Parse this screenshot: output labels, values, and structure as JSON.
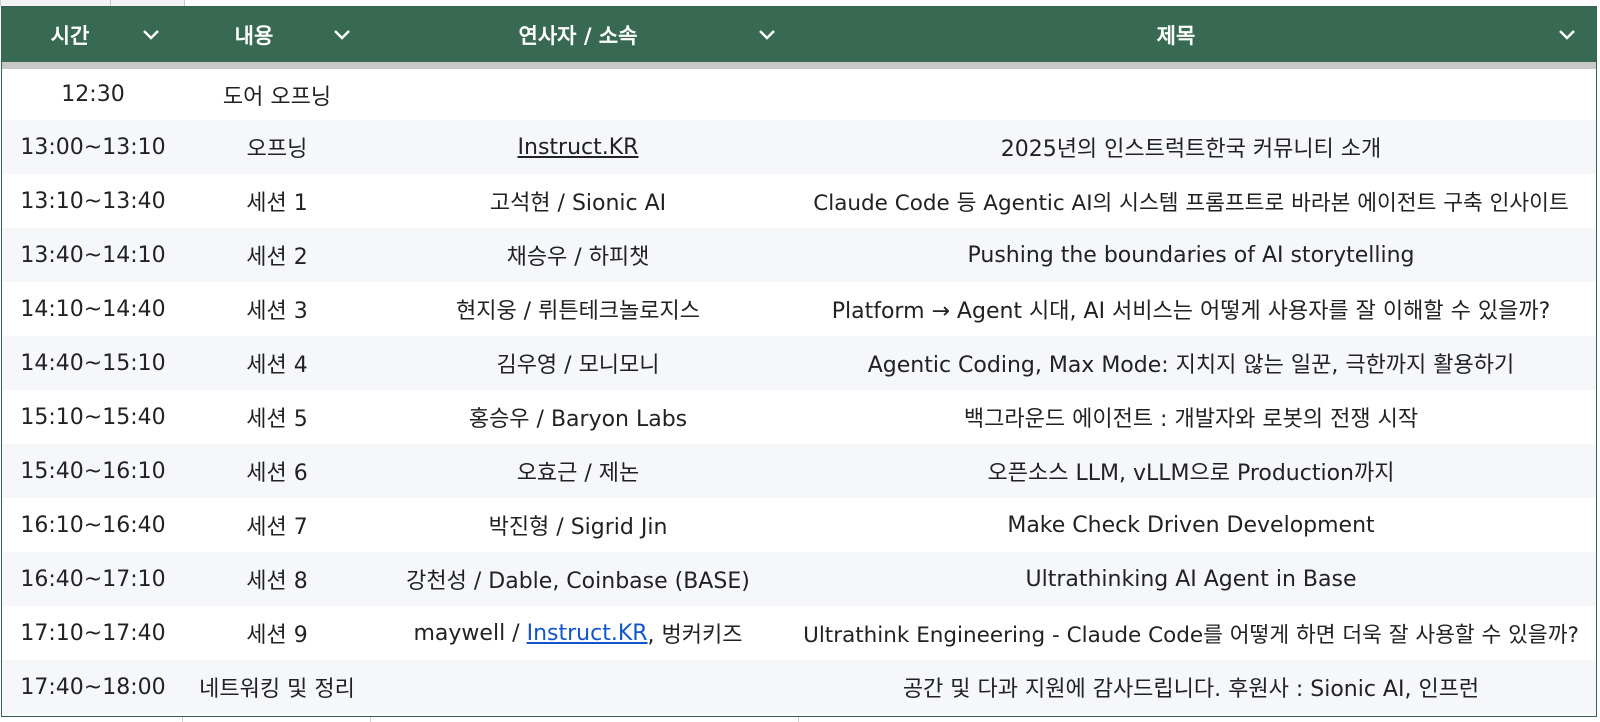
{
  "header": {
    "columns": [
      {
        "label": "시간"
      },
      {
        "label": "내용"
      },
      {
        "label": "연사자 / 소속"
      },
      {
        "label": "제목"
      }
    ]
  },
  "rows": [
    {
      "time": "12:30",
      "content": "도어 오프닝",
      "speaker": "",
      "title": ""
    },
    {
      "time": "13:00~13:10",
      "content": "오프닝",
      "speaker_link": "Instruct.KR",
      "title": "2025년의 인스트럭트한국 커뮤니티 소개"
    },
    {
      "time": "13:10~13:40",
      "content": "세션 1",
      "speaker": "고석현 / Sionic AI",
      "title": "Claude Code 등 Agentic AI의 시스템 프롬프트로 바라본 에이전트 구축 인사이트"
    },
    {
      "time": "13:40~14:10",
      "content": "세션 2",
      "speaker": "채승우 / 하피챗",
      "title": "Pushing the boundaries of AI storytelling"
    },
    {
      "time": "14:10~14:40",
      "content": "세션 3",
      "speaker": "현지웅 / 뤼튼테크놀로지스",
      "title": "Platform → Agent 시대, AI 서비스는 어떻게 사용자를 잘 이해할 수 있을까?"
    },
    {
      "time": "14:40~15:10",
      "content": "세션 4",
      "speaker": "김우영 / 모니모니",
      "title": "Agentic Coding, Max Mode: 지치지 않는 일꾼, 극한까지 활용하기"
    },
    {
      "time": "15:10~15:40",
      "content": "세션 5",
      "speaker": "홍승우 / Baryon Labs",
      "title": "백그라운드 에이전트 : 개발자와 로봇의 전쟁 시작"
    },
    {
      "time": "15:40~16:10",
      "content": "세션 6",
      "speaker": "오효근 / 제논",
      "title": "오픈소스 LLM, vLLM으로 Production까지"
    },
    {
      "time": "16:10~16:40",
      "content": "세션 7",
      "speaker": "박진형 / Sigrid Jin",
      "title": "Make Check Driven Development"
    },
    {
      "time": "16:40~17:10",
      "content": "세션 8",
      "speaker": "강천성 / Dable, Coinbase (BASE)",
      "title": "Ultrathinking AI Agent in Base"
    },
    {
      "time": "17:10~17:40",
      "content": "세션 9",
      "speaker_pre": "maywell / ",
      "speaker_link": "Instruct.KR",
      "speaker_post": ", 벙커키즈",
      "title": "Ultrathink Engineering - Claude Code를 어떻게 하면 더욱 잘 사용할 수 있을까?"
    },
    {
      "time": "17:40~18:00",
      "content": "네트워킹 및 정리",
      "speaker": "",
      "title": "공간 및 다과 지원에 감사드립니다. 후원사 : Sionic AI, 인프런"
    }
  ],
  "icons": {
    "filter": "chevron-down-icon"
  },
  "colors": {
    "header_bg": "#386a53",
    "row_alt": "#f5f7fa",
    "link": "#1155cc"
  }
}
